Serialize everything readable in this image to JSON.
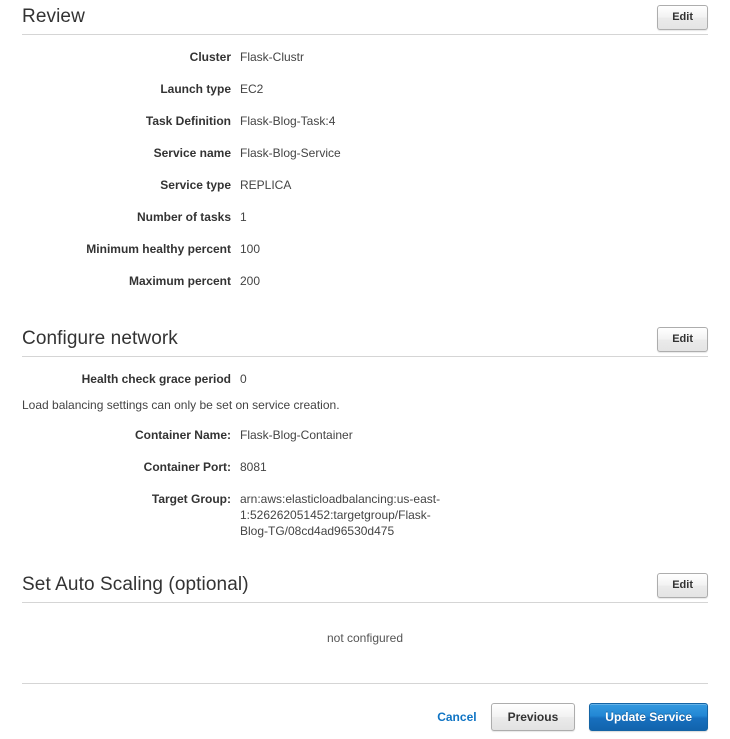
{
  "sections": [
    {
      "id": "review",
      "title": "Review",
      "edit_label": "Edit",
      "rows": [
        {
          "label": "Cluster",
          "value": "Flask-Clustr"
        },
        {
          "label": "Launch type",
          "value": "EC2"
        },
        {
          "label": "Task Definition",
          "value": "Flask-Blog-Task:4"
        },
        {
          "label": "Service name",
          "value": "Flask-Blog-Service"
        },
        {
          "label": "Service type",
          "value": "REPLICA"
        },
        {
          "label": "Number of tasks",
          "value": "1"
        },
        {
          "label": "Minimum healthy percent",
          "value": "100"
        },
        {
          "label": "Maximum percent",
          "value": "200"
        }
      ]
    },
    {
      "id": "configure-network",
      "title": "Configure network",
      "edit_label": "Edit",
      "rows_top": [
        {
          "label": "Health check grace period",
          "value": "0"
        }
      ],
      "note": "Load balancing settings can only be set on service creation.",
      "rows_bottom": [
        {
          "label": "Container Name:",
          "value": "Flask-Blog-Container"
        },
        {
          "label": "Container Port:",
          "value": "8081"
        },
        {
          "label": "Target Group:",
          "value": "arn:aws:elasticloadbalancing:us-east-1:526262051452:targetgroup/Flask-Blog-TG/08cd4ad96530d475"
        }
      ]
    },
    {
      "id": "set-auto-scaling",
      "title": "Set Auto Scaling (optional)",
      "edit_label": "Edit",
      "empty_text": "not configured"
    }
  ],
  "footer": {
    "cancel_label": "Cancel",
    "previous_label": "Previous",
    "submit_label": "Update Service"
  },
  "colors": {
    "primary": "#1f7fc4",
    "link": "#0f74c4",
    "rule": "#d5d5d5",
    "text": "#333333"
  }
}
